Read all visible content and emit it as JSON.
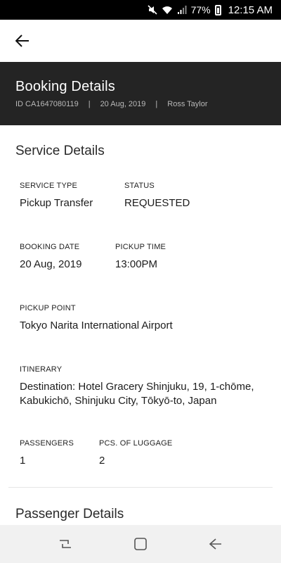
{
  "status_bar": {
    "battery": "77%",
    "time": "12:15 AM",
    "icons": [
      "mute-icon",
      "wifi-icon",
      "signal-icon",
      "battery-icon"
    ]
  },
  "top_bar": {
    "back_icon": "arrow-left-icon"
  },
  "header": {
    "title": "Booking Details",
    "booking_id": "ID CA1647080119",
    "date": "20 Aug, 2019",
    "customer": "Ross Taylor",
    "separator": "|"
  },
  "service_details": {
    "title": "Service Details",
    "service_type": {
      "label": "SERVICE TYPE",
      "value": "Pickup Transfer"
    },
    "status": {
      "label": "STATUS",
      "value": "REQUESTED"
    },
    "booking_date": {
      "label": "BOOKING DATE",
      "value": "20 Aug, 2019"
    },
    "pickup_time": {
      "label": "PICKUP TIME",
      "value": "13:00PM"
    },
    "pickup_point": {
      "label": "PICKUP POINT",
      "value": "Tokyo Narita International Airport"
    },
    "itinerary": {
      "label": "ITINERARY",
      "value": "Destination: Hotel Gracery Shinjuku, 19, 1-chōme, Kabukichō, Shinjuku City, Tōkyō-to, Japan"
    },
    "passengers": {
      "label": "PASSENGERS",
      "value": "1"
    },
    "luggage": {
      "label": "PCS. OF LUGGAGE",
      "value": "2"
    }
  },
  "passenger_details": {
    "title": "Passenger Details"
  },
  "nav_bar": {
    "icons": [
      "recent-apps-icon",
      "home-icon",
      "back-icon"
    ]
  },
  "colors": {
    "header_bg": "#242424",
    "nav_bg": "#f1f1f1",
    "status_bg": "#000000"
  }
}
